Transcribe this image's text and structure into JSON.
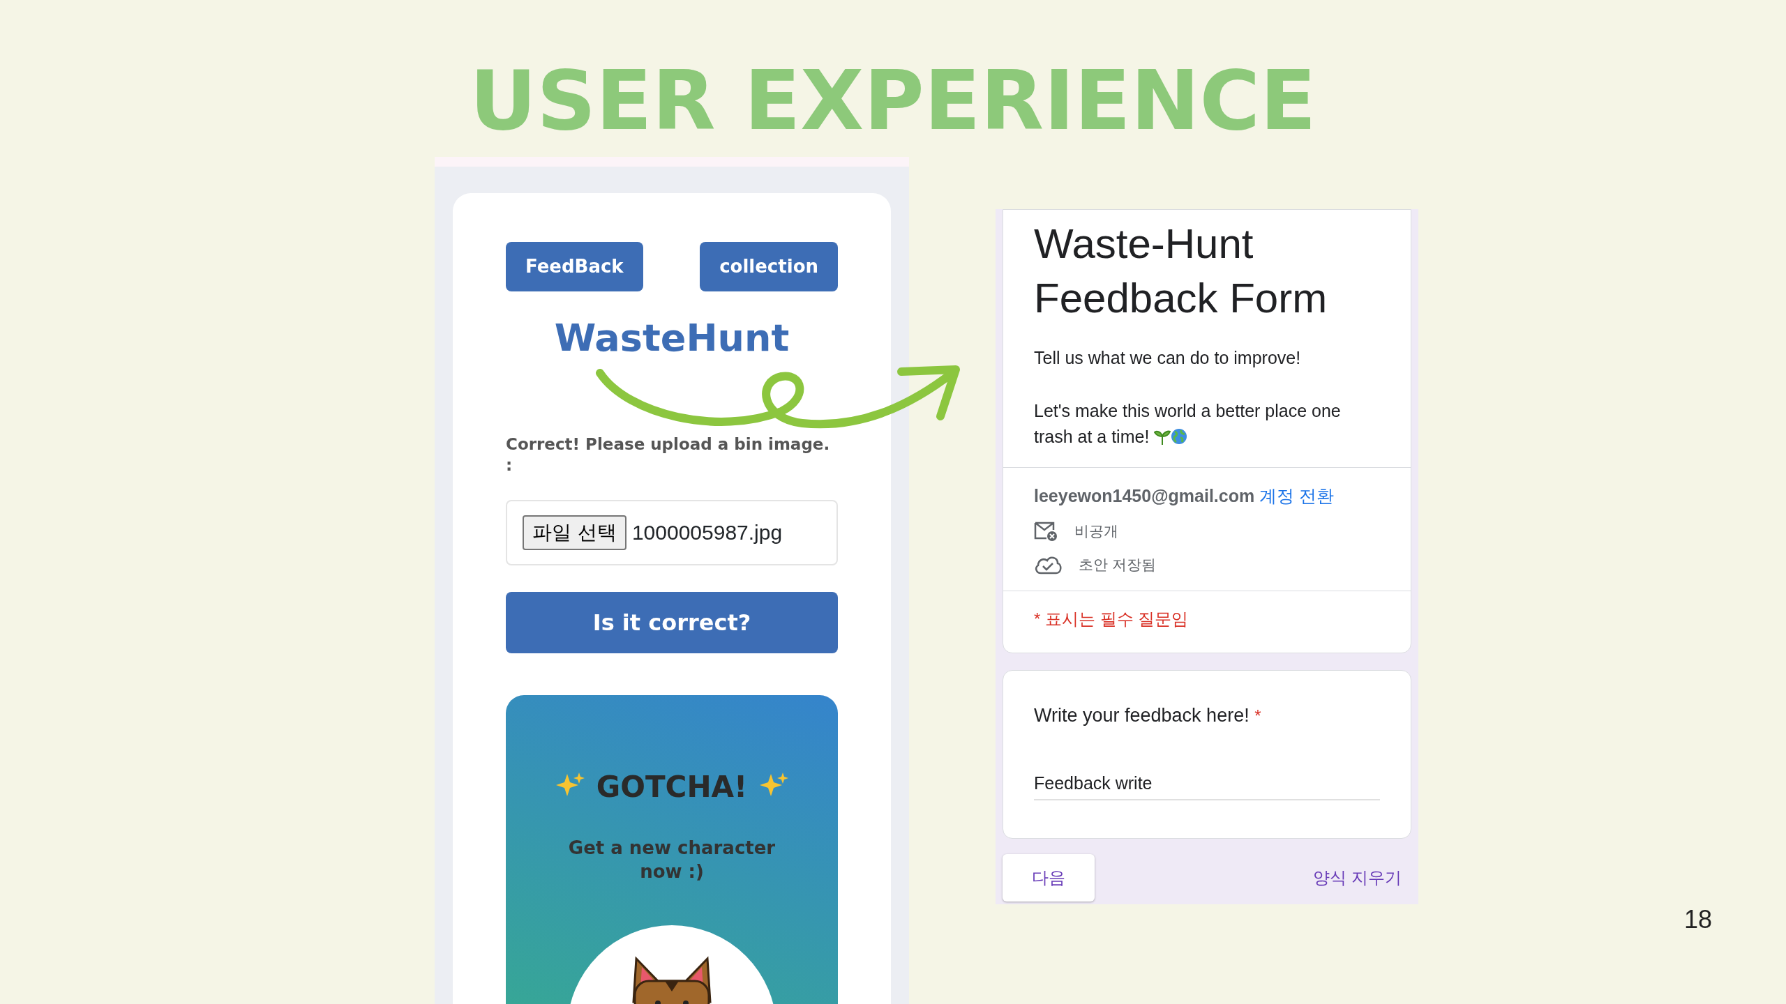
{
  "slide": {
    "title": "USER EXPERIENCE",
    "page_number": "18"
  },
  "app_screen": {
    "nav_buttons": [
      "FeedBack",
      "collection"
    ],
    "logo": "WasteHunt",
    "prompt": "Correct! Please upload a bin image.",
    "prompt_suffix": ":",
    "file_input": {
      "button": "파일 선택",
      "value": "1000005987.jpg"
    },
    "submit_button": "Is it correct?",
    "gotcha_card": {
      "title": "GOTCHA!",
      "subtitle": "Get a new character now :)"
    }
  },
  "form_screen": {
    "title": "Waste-Hunt Feedback Form",
    "description": [
      "Tell us what we can do to improve!",
      "Let's make this world a better place one trash at a time!"
    ],
    "account": {
      "email": "leeyewon1450@gmail.com",
      "switch_link": "계정 전환"
    },
    "privacy": "비공개",
    "draft_status": "초안 저장됨",
    "required_note": "* 표시는 필수 질문임",
    "question": {
      "label": "Write your feedback here!",
      "required_mark": "*",
      "value": "Feedback write"
    },
    "next_button": "다음",
    "clear_link": "양식 지우기"
  }
}
